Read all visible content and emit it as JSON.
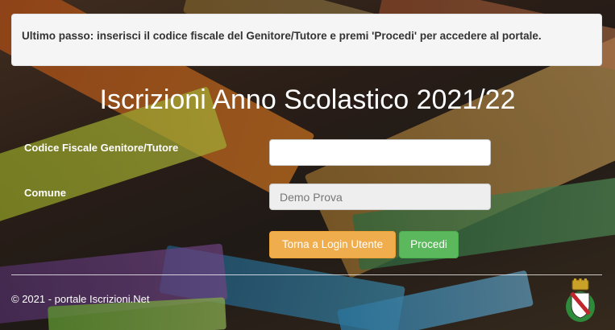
{
  "notice": {
    "text": "Ultimo passo: inserisci il codice fiscale del Genitore/Tutore e premi 'Procedi' per accedere al portale."
  },
  "page": {
    "title": "Iscrizioni Anno Scolastico 2021/22"
  },
  "form": {
    "codice_fiscale_label": "Codice Fiscale Genitore/Tutore",
    "codice_fiscale_value": "",
    "comune_label": "Comune",
    "comune_value": "Demo Prova",
    "back_button_label": "Torna a Login Utente",
    "proceed_button_label": "Procedi"
  },
  "footer": {
    "copyright": "© 2021 - portale Iscrizioni.Net",
    "crest_icon": "municipal-crest-icon"
  },
  "colors": {
    "back_button": "#f0ad4e",
    "proceed_button": "#5cb85c",
    "notice_bg": "#f5f5f5"
  }
}
